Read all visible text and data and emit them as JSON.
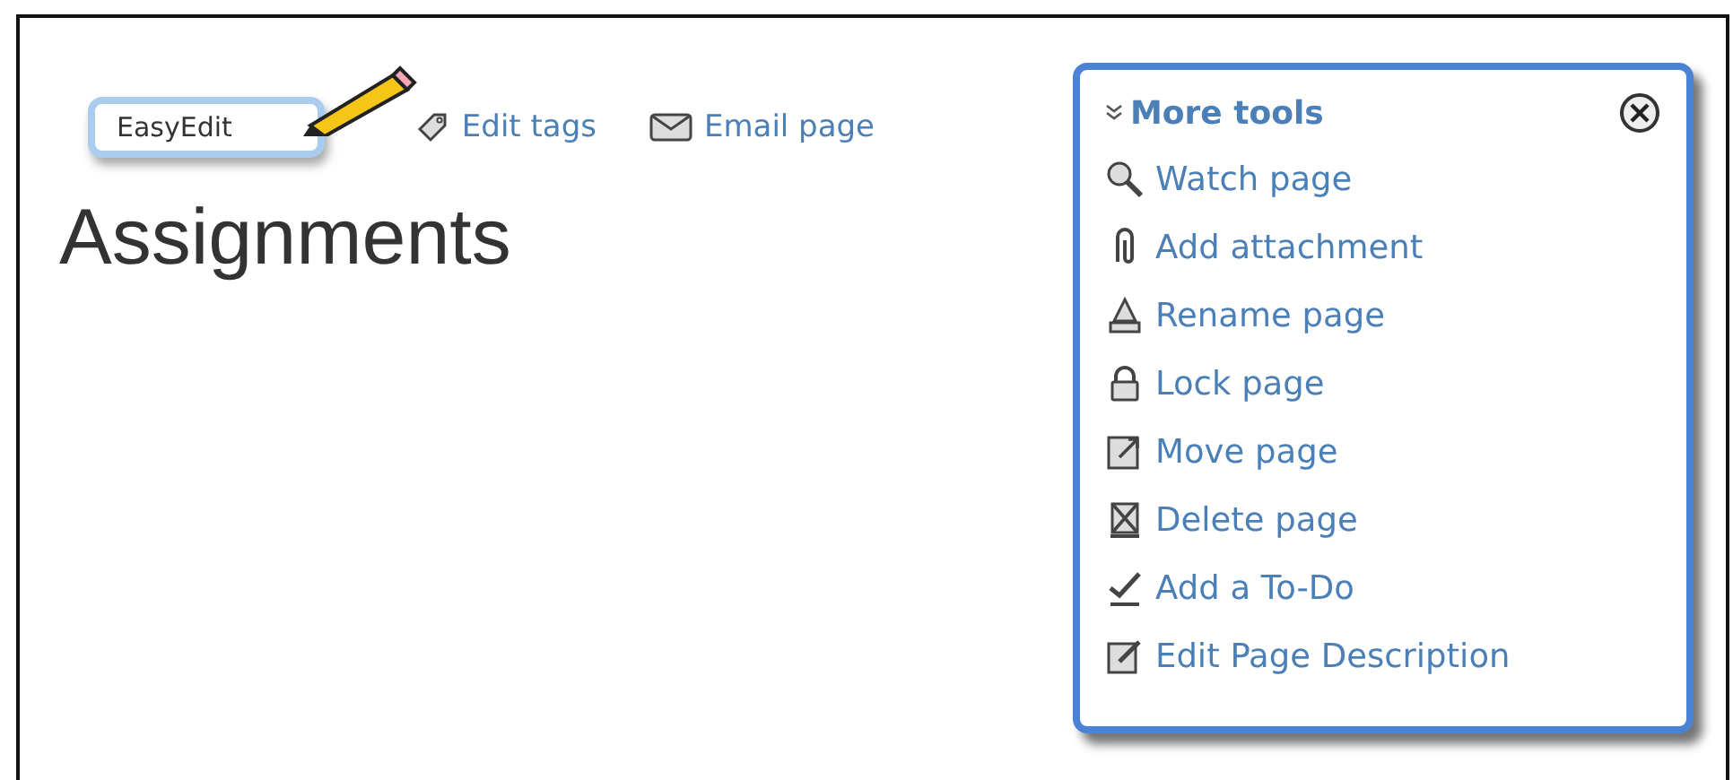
{
  "toolbar": {
    "easyedit": "EasyEdit",
    "links": [
      {
        "kind": "tag",
        "label": "Edit tags"
      },
      {
        "kind": "mail",
        "label": "Email page"
      }
    ]
  },
  "page_title": "Assignments",
  "more_tools": {
    "title": "More tools",
    "items": [
      {
        "kind": "watch",
        "label": "Watch page"
      },
      {
        "kind": "attach",
        "label": "Add attachment"
      },
      {
        "kind": "rename",
        "label": "Rename page"
      },
      {
        "kind": "lock",
        "label": "Lock page"
      },
      {
        "kind": "move",
        "label": "Move page"
      },
      {
        "kind": "delete",
        "label": "Delete page"
      },
      {
        "kind": "todo",
        "label": "Add a To-Do"
      },
      {
        "kind": "describe",
        "label": "Edit Page Description"
      }
    ]
  }
}
